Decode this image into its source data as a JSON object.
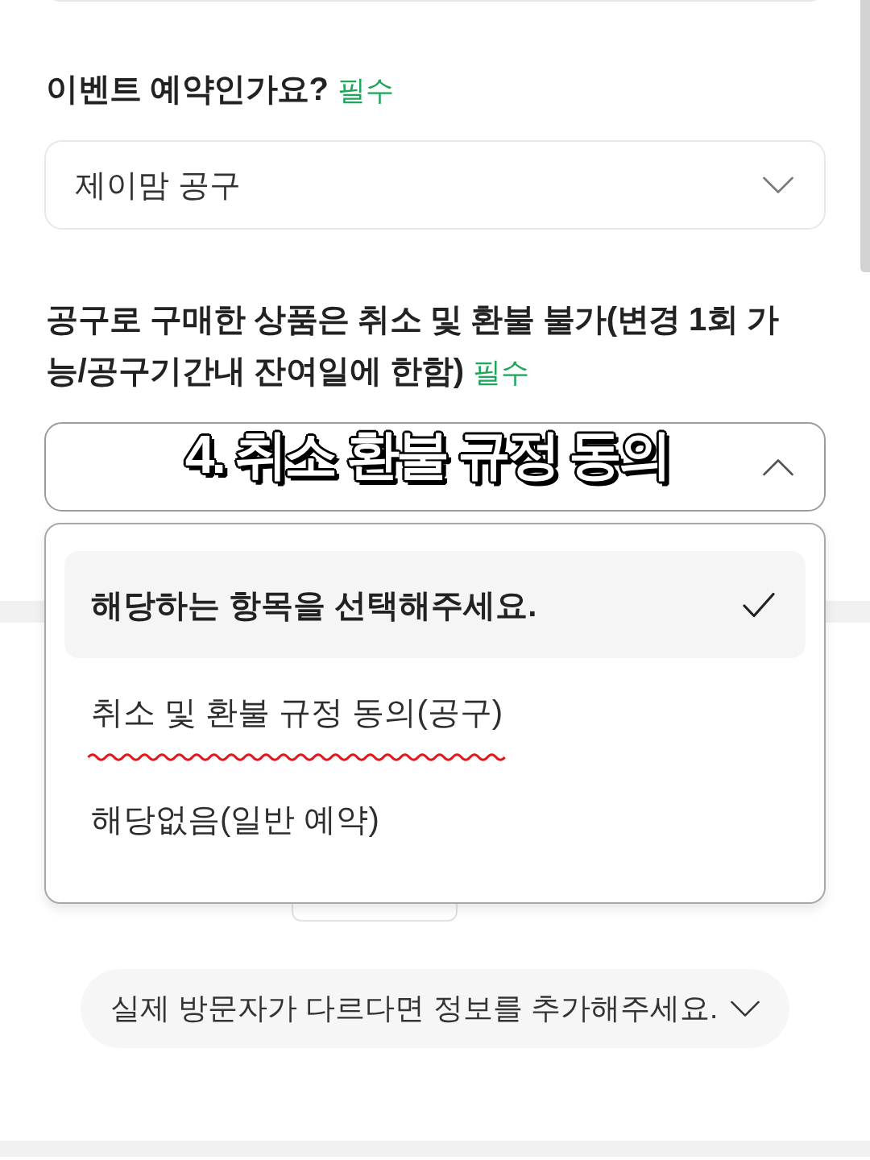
{
  "questions": [
    {
      "label": "이벤트 예약인가요?",
      "required_tag": "필수",
      "select": {
        "value": "제이맘 공구",
        "expanded": false
      }
    },
    {
      "label": "공구로 구매한 상품은 취소 및 환불 불가(변경 1회 가능/공구기간내 잔여일에 한함)",
      "required_tag": "필수",
      "select": {
        "expanded": true,
        "options": [
          {
            "label": "해당하는 항목을 선택해주세요.",
            "selected": true,
            "squiggle_underline": false
          },
          {
            "label": "취소 및 환불 규정 동의(공구)",
            "selected": false,
            "squiggle_underline": true
          },
          {
            "label": "해당없음(일반 예약)",
            "selected": false,
            "squiggle_underline": false
          }
        ]
      }
    }
  ],
  "add_visitor_button": {
    "label": "실제 방문자가 다르다면 정보를 추가해주세요."
  },
  "overlay_caption": "4. 취소 환불 규정 동의"
}
